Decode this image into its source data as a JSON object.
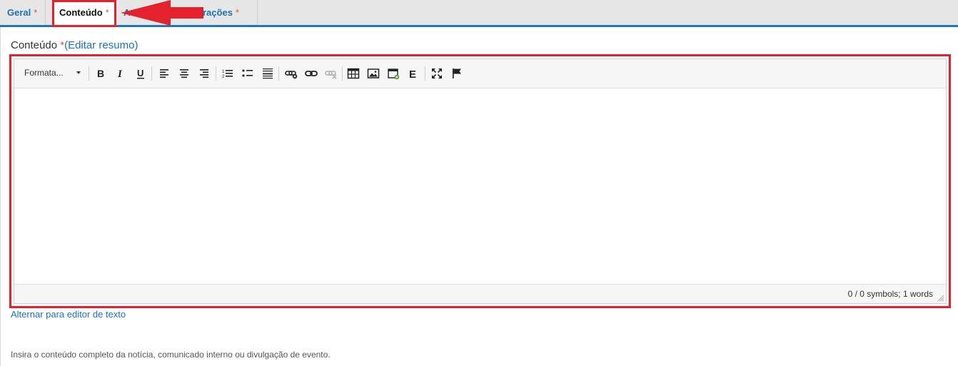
{
  "tabs": [
    {
      "label": "Geral",
      "required": "*"
    },
    {
      "label": "Conteúdo",
      "required": "*"
    },
    {
      "label": "A",
      "required": ""
    },
    {
      "label": "rações",
      "required": "*"
    }
  ],
  "field": {
    "label": "Conteúdo",
    "required": "*",
    "edit_summary_link": "(Editar resumo)"
  },
  "toolbar": {
    "format_select": "Formata...",
    "buttons": [
      "bold",
      "italic",
      "underline",
      "align-left",
      "align-center",
      "align-right",
      "ordered-list",
      "unordered-list",
      "horizontal-rule",
      "insert-link",
      "link",
      "unlink",
      "table",
      "image",
      "media",
      "e-button",
      "fullscreen",
      "flag"
    ]
  },
  "status": {
    "counter": "0 / 0 symbols; 1 words"
  },
  "switch_editor_link": "Alternar para editor de texto",
  "help_text": "Insira o conteúdo completo da notícia, comunicado interno ou divulgação de evento.",
  "colors": {
    "accent": "#1f77b4",
    "highlight": "#e3222d",
    "required": "#d9534f"
  }
}
